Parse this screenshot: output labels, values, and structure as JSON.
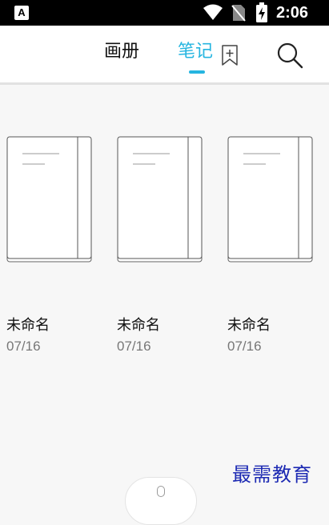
{
  "status_bar": {
    "app_icon_letter": "A",
    "time": "2:06"
  },
  "header": {
    "tabs": [
      {
        "label": "画册",
        "active": false
      },
      {
        "label": "笔记",
        "active": true
      }
    ],
    "accent_color": "#25b5e0"
  },
  "notebooks": [
    {
      "title": "未命名",
      "date": "07/16"
    },
    {
      "title": "未命名",
      "date": "07/16"
    },
    {
      "title": "未命名",
      "date": "07/16"
    }
  ],
  "watermark": {
    "text": "最需教育",
    "color": "#1d2ab3"
  },
  "icons": [
    "wifi-icon",
    "no-sim-icon",
    "battery-icon",
    "bookmark-plus-icon",
    "search-icon",
    "notebook-icon"
  ]
}
